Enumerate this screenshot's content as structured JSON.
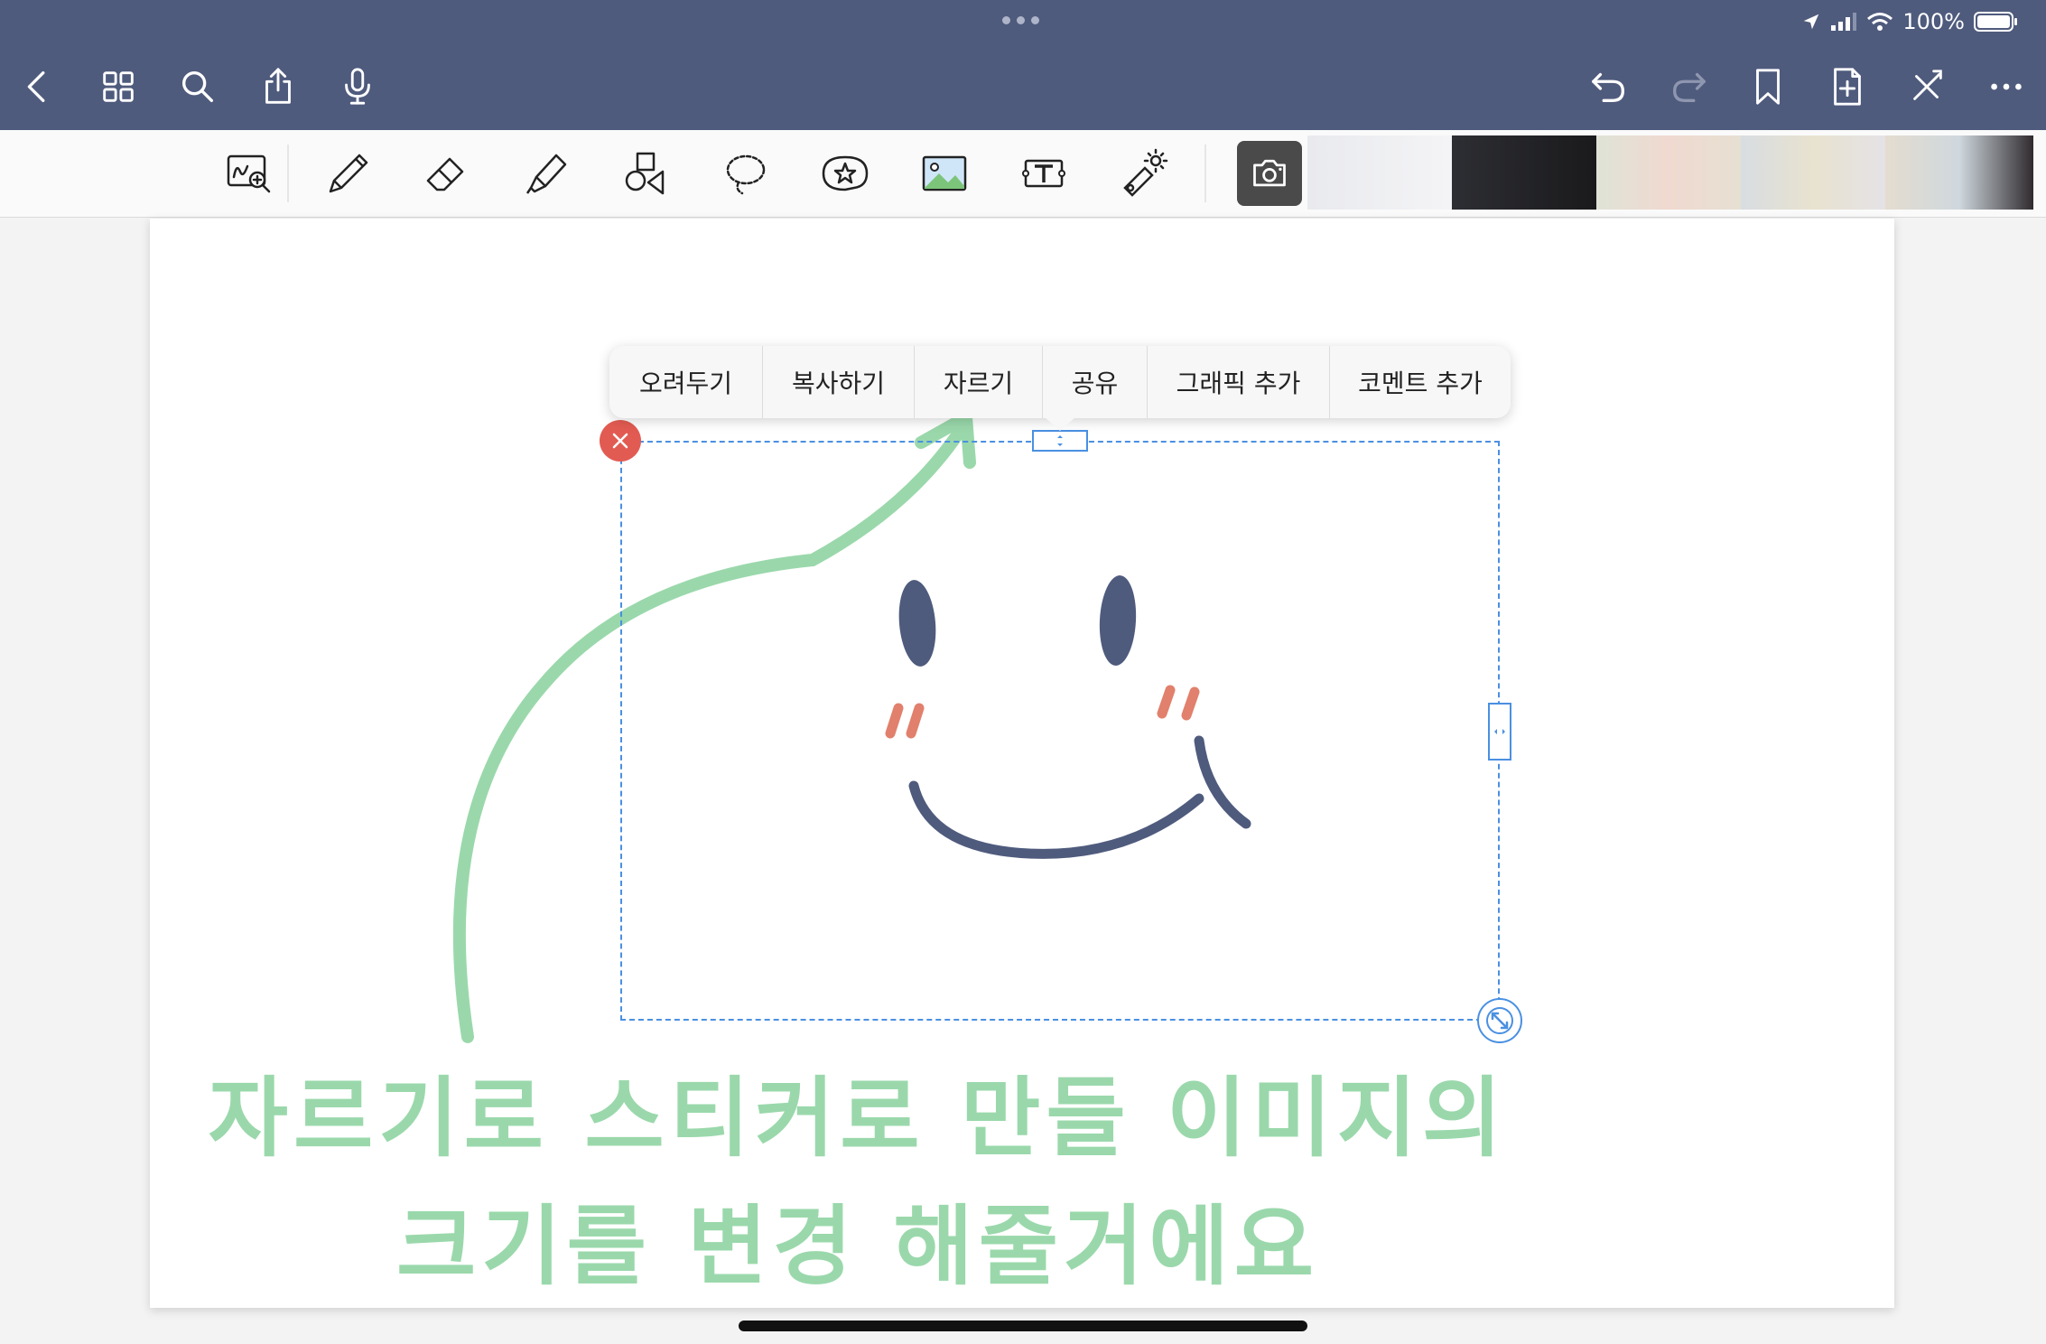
{
  "status_bar": {
    "battery_text": "100%"
  },
  "nav_left": [
    {
      "name": "back-icon"
    },
    {
      "name": "grid-icon"
    },
    {
      "name": "search-icon"
    },
    {
      "name": "share-icon"
    },
    {
      "name": "microphone-icon"
    }
  ],
  "nav_right": [
    {
      "name": "undo-icon"
    },
    {
      "name": "redo-icon"
    },
    {
      "name": "bookmark-icon"
    },
    {
      "name": "add-page-icon"
    },
    {
      "name": "close-editing-icon"
    },
    {
      "name": "more-icon"
    }
  ],
  "tools": [
    {
      "name": "zoom-handwriting-icon"
    },
    {
      "name": "pencil-icon"
    },
    {
      "name": "eraser-icon"
    },
    {
      "name": "highlighter-icon"
    },
    {
      "name": "shapes-icon"
    },
    {
      "name": "lasso-icon"
    },
    {
      "name": "sticker-icon"
    },
    {
      "name": "image-icon"
    },
    {
      "name": "text-box-icon"
    },
    {
      "name": "laser-pointer-icon"
    },
    {
      "name": "camera-icon"
    }
  ],
  "context_menu": {
    "items": [
      "오려두기",
      "복사하기",
      "자르기",
      "공유",
      "그래픽 추가",
      "코멘트 추가"
    ]
  },
  "caption": {
    "line1": "자르기로 스티커로 만들 이미지의",
    "line2": "크기를 변경 해줄거에요"
  },
  "colors": {
    "top_bar": "#4f5b7d",
    "face": "#4f5b7d",
    "blush": "#e1806c",
    "handwriting": "#9ad8ab",
    "selection": "#4a90e2",
    "close_button": "#e25b52"
  }
}
